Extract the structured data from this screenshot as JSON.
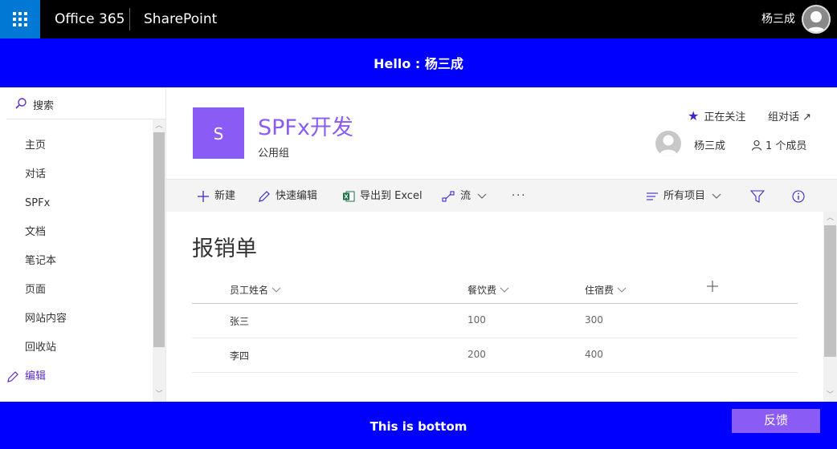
{
  "suitebar": {
    "brand": "Office 365",
    "app": "SharePoint",
    "user_name": "杨三成"
  },
  "hello": {
    "text": "Hello : 杨三成"
  },
  "leftnav": {
    "search_label": "搜索",
    "items": [
      {
        "label": "主页"
      },
      {
        "label": "对话"
      },
      {
        "label": "SPFx"
      },
      {
        "label": "文档"
      },
      {
        "label": "笔记本"
      },
      {
        "label": "页面"
      },
      {
        "label": "网站内容"
      },
      {
        "label": "回收站"
      }
    ],
    "edit_label": "编辑"
  },
  "site": {
    "logo_letter": "S",
    "title": "SPFx开发",
    "subtitle": "公用组",
    "follow_label": "正在关注",
    "conversations_label": "组对话 ↗",
    "member_name": "杨三成",
    "member_count": "1 个成员"
  },
  "cmdbar": {
    "new": "新建",
    "quick_edit": "快速编辑",
    "export": "导出到 Excel",
    "flow": "流",
    "more": "···",
    "view": "所有项目"
  },
  "list": {
    "title": "报销单",
    "columns": [
      "员工姓名",
      "餐饮费",
      "住宿费"
    ],
    "rows": [
      {
        "name": "张三",
        "meal": "100",
        "lodging": "300"
      },
      {
        "name": "李四",
        "meal": "200",
        "lodging": "400"
      }
    ]
  },
  "bottom": {
    "text": "This is bottom",
    "feedback": "反馈"
  },
  "colors": {
    "accent_blue": "#0000ff",
    "waffle_blue": "#0078d4",
    "site_purple": "#8a5cf5"
  }
}
